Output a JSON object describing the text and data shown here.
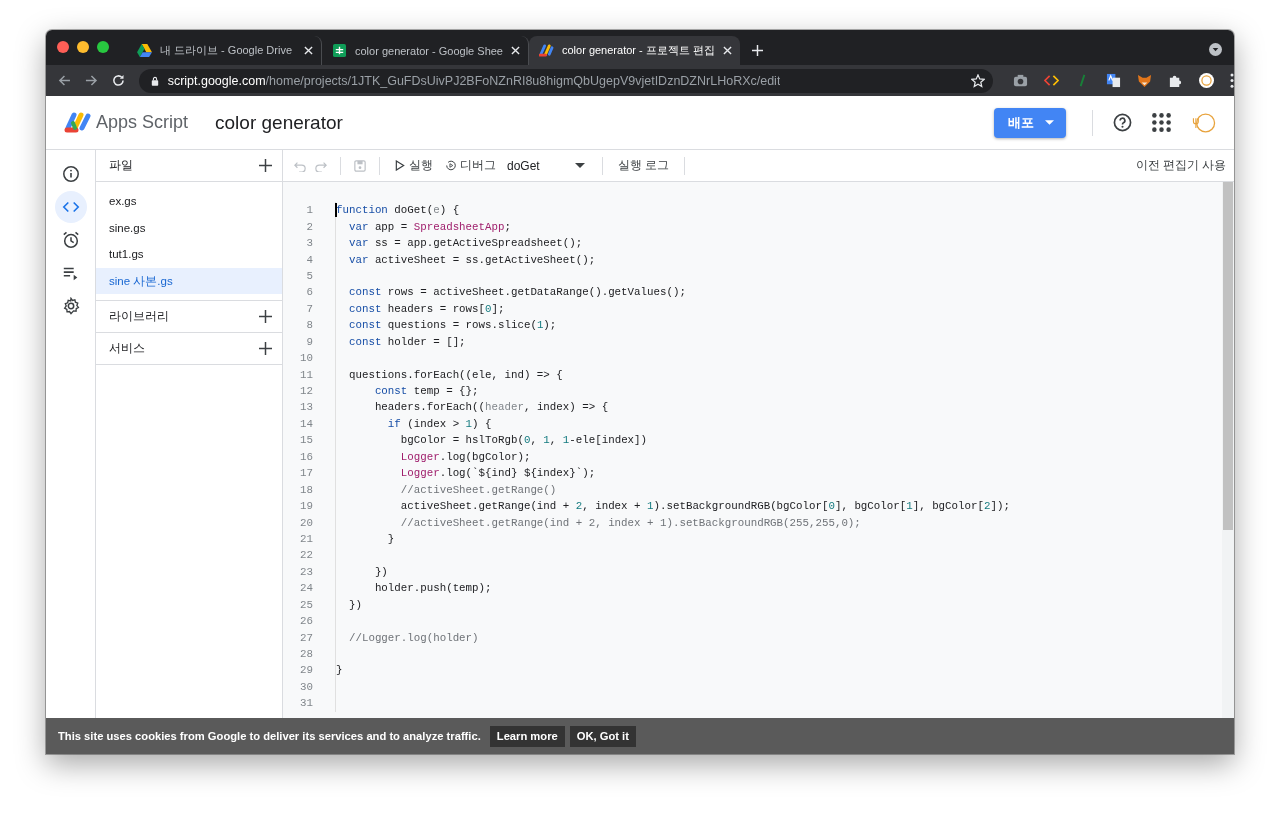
{
  "browser": {
    "tabs": [
      {
        "title": "내 드라이브 - Google Drive",
        "kind": "drive",
        "selected": false
      },
      {
        "title": "color generator - Google Shee",
        "kind": "sheets",
        "selected": false
      },
      {
        "title": "color generator - 프로젝트 편집",
        "kind": "script",
        "selected": true
      }
    ],
    "url": {
      "host": "script.google.com",
      "path": "/home/projects/1JTK_GuFDsUivPJ2BFoNZnRI8u8higmQbUgepV9vjetIDznDZNrLHoRXc/edit"
    }
  },
  "app": {
    "product": "Apps Script",
    "project": "color generator",
    "deploy_button": "배포"
  },
  "rail": [
    {
      "kind": "info",
      "selected": false
    },
    {
      "kind": "code",
      "selected": true
    },
    {
      "kind": "alarm",
      "selected": false
    },
    {
      "kind": "executions",
      "selected": false
    },
    {
      "kind": "settings",
      "selected": false
    }
  ],
  "files": {
    "title": "파일",
    "items": [
      {
        "name": "ex.gs",
        "selected": false
      },
      {
        "name": "sine.gs",
        "selected": false
      },
      {
        "name": "tut1.gs",
        "selected": false
      },
      {
        "name": "sine 사본.gs",
        "selected": true
      }
    ]
  },
  "sections": [
    {
      "title": "라이브러리"
    },
    {
      "title": "서비스"
    }
  ],
  "toolbar": {
    "undo_disabled": true,
    "redo_disabled": true,
    "run": "실행",
    "debug": "디버그",
    "function": "doGet",
    "log": "실행 로그",
    "legacy": "이전 편집기 사용"
  },
  "code": {
    "lines": [
      {
        "n": "1",
        "tokens": [
          {
            "kind": "keyword",
            "text": "function"
          },
          {
            "kind": "plain",
            "text": " doGet("
          },
          {
            "kind": "param",
            "text": "e"
          },
          {
            "kind": "plain",
            "text": ") {"
          }
        ]
      },
      {
        "n": "2",
        "tokens": [
          {
            "kind": "keyword",
            "text": "  var"
          },
          {
            "kind": "plain",
            "text": " app = "
          },
          {
            "kind": "class",
            "text": "SpreadsheetApp"
          },
          {
            "kind": "plain",
            "text": ";"
          }
        ]
      },
      {
        "n": "3",
        "tokens": [
          {
            "kind": "keyword",
            "text": "  var"
          },
          {
            "kind": "plain",
            "text": " ss = app.getActiveSpreadsheet();"
          }
        ]
      },
      {
        "n": "4",
        "tokens": [
          {
            "kind": "keyword",
            "text": "  var"
          },
          {
            "kind": "plain",
            "text": " activeSheet = ss.getActiveSheet();"
          }
        ]
      },
      {
        "n": "5"
      },
      {
        "n": "6",
        "tokens": [
          {
            "kind": "keyword",
            "text": "  const"
          },
          {
            "kind": "plain",
            "text": " rows = activeSheet.getDataRange().getValues();"
          }
        ]
      },
      {
        "n": "7",
        "tokens": [
          {
            "kind": "keyword",
            "text": "  const"
          },
          {
            "kind": "plain",
            "text": " headers = rows["
          },
          {
            "kind": "number",
            "text": "0"
          },
          {
            "kind": "plain",
            "text": "];"
          }
        ]
      },
      {
        "n": "8",
        "tokens": [
          {
            "kind": "keyword",
            "text": "  const"
          },
          {
            "kind": "plain",
            "text": " questions = rows.slice("
          },
          {
            "kind": "number",
            "text": "1"
          },
          {
            "kind": "plain",
            "text": ");"
          }
        ]
      },
      {
        "n": "9",
        "tokens": [
          {
            "kind": "keyword",
            "text": "  const"
          },
          {
            "kind": "plain",
            "text": " holder = [];"
          }
        ]
      },
      {
        "n": "10"
      },
      {
        "n": "11",
        "tokens": [
          {
            "kind": "plain",
            "text": "  questions.forEach((ele, ind) => {"
          }
        ]
      },
      {
        "n": "12",
        "tokens": [
          {
            "kind": "keyword",
            "text": "      const"
          },
          {
            "kind": "plain",
            "text": " temp = {};"
          }
        ]
      },
      {
        "n": "13",
        "tokens": [
          {
            "kind": "plain",
            "text": "      headers.forEach(("
          },
          {
            "kind": "param",
            "text": "header"
          },
          {
            "kind": "plain",
            "text": ", index) => {"
          }
        ]
      },
      {
        "n": "14",
        "tokens": [
          {
            "kind": "keyword",
            "text": "        if"
          },
          {
            "kind": "plain",
            "text": " (index > "
          },
          {
            "kind": "number",
            "text": "1"
          },
          {
            "kind": "plain",
            "text": ") {"
          }
        ]
      },
      {
        "n": "15",
        "tokens": [
          {
            "kind": "plain",
            "text": "          bgColor = hslToRgb("
          },
          {
            "kind": "number",
            "text": "0"
          },
          {
            "kind": "plain",
            "text": ", "
          },
          {
            "kind": "number",
            "text": "1"
          },
          {
            "kind": "plain",
            "text": ", "
          },
          {
            "kind": "number",
            "text": "1"
          },
          {
            "kind": "plain",
            "text": "-ele[index])"
          }
        ]
      },
      {
        "n": "16",
        "tokens": [
          {
            "kind": "class",
            "text": "          Logger"
          },
          {
            "kind": "plain",
            "text": ".log(bgColor);"
          }
        ]
      },
      {
        "n": "17",
        "tokens": [
          {
            "kind": "class",
            "text": "          Logger"
          },
          {
            "kind": "plain",
            "text": ".log(`${ind} ${index}`);"
          }
        ]
      },
      {
        "n": "18",
        "tokens": [
          {
            "kind": "comment",
            "text": "          //activeSheet.getRange()"
          }
        ]
      },
      {
        "n": "19",
        "tokens": [
          {
            "kind": "plain",
            "text": "          activeSheet.getRange(ind + "
          },
          {
            "kind": "number",
            "text": "2"
          },
          {
            "kind": "plain",
            "text": ", index + "
          },
          {
            "kind": "number",
            "text": "1"
          },
          {
            "kind": "plain",
            "text": ").setBackgroundRGB(bgColor["
          },
          {
            "kind": "number",
            "text": "0"
          },
          {
            "kind": "plain",
            "text": "], bgColor["
          },
          {
            "kind": "number",
            "text": "1"
          },
          {
            "kind": "plain",
            "text": "], bgColor["
          },
          {
            "kind": "number",
            "text": "2"
          },
          {
            "kind": "plain",
            "text": "]);"
          }
        ]
      },
      {
        "n": "20",
        "tokens": [
          {
            "kind": "comment",
            "text": "          //activeSheet.getRange(ind + 2, index + 1).setBackgroundRGB(255,255,0);"
          }
        ]
      },
      {
        "n": "21",
        "tokens": [
          {
            "kind": "plain",
            "text": "        }"
          }
        ]
      },
      {
        "n": "22"
      },
      {
        "n": "23",
        "tokens": [
          {
            "kind": "plain",
            "text": "      })"
          }
        ]
      },
      {
        "n": "24",
        "tokens": [
          {
            "kind": "plain",
            "text": "      holder.push(temp);"
          }
        ]
      },
      {
        "n": "25",
        "tokens": [
          {
            "kind": "plain",
            "text": "  })"
          }
        ]
      },
      {
        "n": "26"
      },
      {
        "n": "27",
        "tokens": [
          {
            "kind": "comment",
            "text": "  //Logger.log(holder)"
          }
        ]
      },
      {
        "n": "28"
      },
      {
        "n": "29",
        "tokens": [
          {
            "kind": "plain",
            "text": "}"
          }
        ]
      },
      {
        "n": "30"
      },
      {
        "n": "31"
      }
    ]
  },
  "cookie_bar": {
    "text": "This site uses cookies from Google to deliver its services and to analyze traffic.",
    "buttons": [
      "Learn more",
      "OK, Got it"
    ]
  }
}
